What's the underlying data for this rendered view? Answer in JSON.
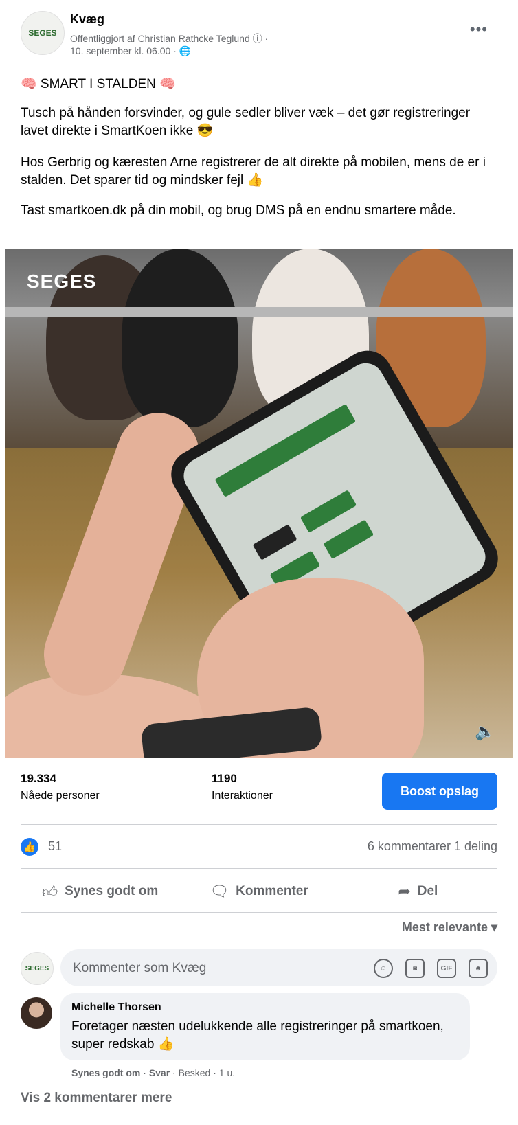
{
  "post": {
    "page_name": "Kvæg",
    "avatar_text": "SEGES",
    "published_by": "Offentliggjort af Christian Rathcke Teglund",
    "timestamp": "10. september kl. 06.00",
    "more_label": "•••",
    "title": "🧠 SMART I STALDEN 🧠",
    "paragraph1": "Tusch på hånden forsvinder, og gule sedler bliver væk – det gør registreringer lavet direkte i SmartKoen ikke 😎",
    "paragraph2": "Hos Gerbrig og kæresten Arne registrerer de alt direkte på mobilen, mens de er i stalden. Det sparer tid og mindsker fejl 👍",
    "paragraph3": "Tast smartkoen.dk på din mobil, og brug DMS på en endnu smartere måde."
  },
  "media": {
    "watermark": "SEGES",
    "volume_icon": "🔈"
  },
  "stats": {
    "reach_value": "19.334",
    "reach_label": "Nåede personer",
    "interactions_value": "1190",
    "interactions_label": "Interaktioner",
    "boost_label": "Boost opslag"
  },
  "reactions": {
    "like_count": "51",
    "comments_shares": "6 kommentarer  1 deling"
  },
  "actions": {
    "like_label": "Synes godt om",
    "comment_label": "Kommenter",
    "share_label": "Del"
  },
  "comments": {
    "sort_label": "Mest relevante ▾",
    "input_placeholder": "Kommenter som Kvæg",
    "items": [
      {
        "author": "Michelle Thorsen",
        "text": "Foretager næsten udelukkende alle registreringer på smartkoen, super redskab 👍",
        "like_action": "Synes godt om",
        "reply_action": "Svar",
        "message_action": "Besked",
        "age": "1 u."
      }
    ],
    "view_more": "Vis 2 kommentarer mere"
  },
  "colors": {
    "accent": "#1877f2",
    "secondary_text": "#65676b"
  }
}
